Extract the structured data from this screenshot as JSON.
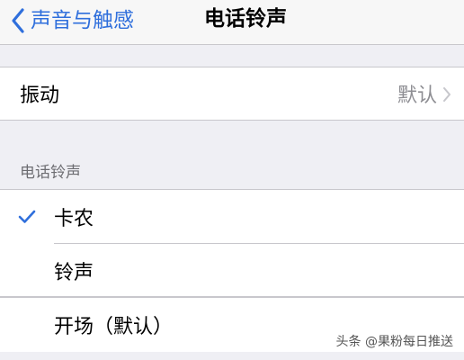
{
  "nav": {
    "back_label": "声音与触感",
    "title": "电话铃声"
  },
  "vibration": {
    "label": "振动",
    "value": "默认"
  },
  "ringtones": {
    "header": "电话铃声",
    "items": [
      {
        "label": "卡农",
        "selected": true
      },
      {
        "label": "铃声",
        "selected": false
      },
      {
        "label": "开场（默认）",
        "selected": false
      }
    ]
  },
  "watermark": "头条 @果粉每日推送",
  "colors": {
    "accent": "#2f6fdc",
    "background": "#efeff4",
    "secondary_text": "#8e8e93"
  }
}
